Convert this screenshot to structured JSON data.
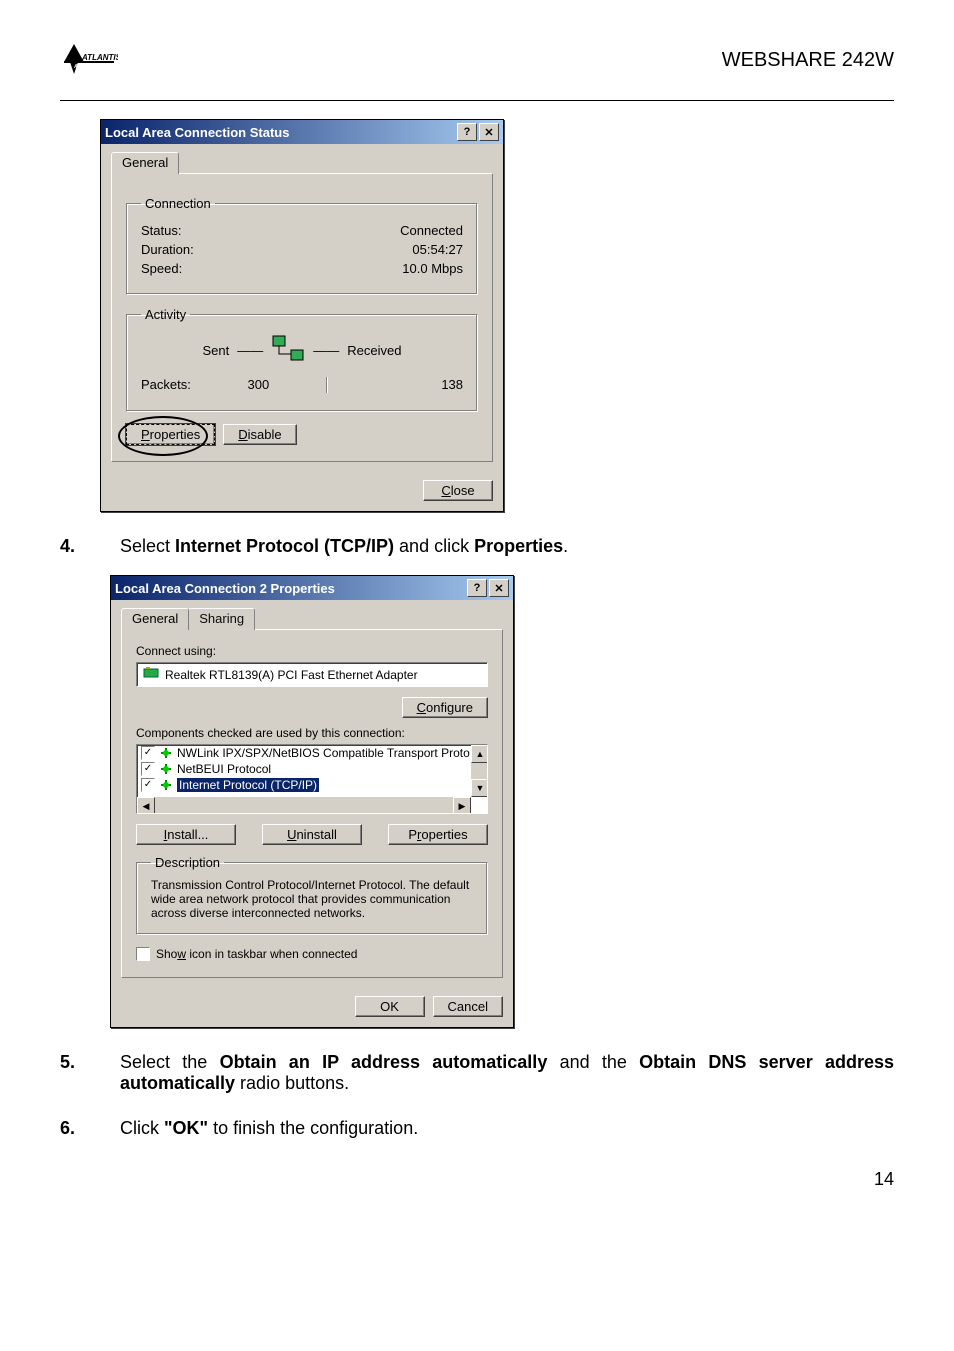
{
  "header": {
    "logo_text": "ATLANTIS",
    "product": "WEBSHARE 242W"
  },
  "dialog1": {
    "title": "Local Area Connection Status",
    "tab_general": "General",
    "conn_legend": "Connection",
    "status_label": "Status:",
    "status_value": "Connected",
    "duration_label": "Duration:",
    "duration_value": "05:54:27",
    "speed_label": "Speed:",
    "speed_value": "10.0 Mbps",
    "activity_legend": "Activity",
    "sent_label": "Sent",
    "received_label": "Received",
    "packets_label": "Packets:",
    "packets_sent": "300",
    "packets_recv": "138",
    "btn_properties": "Properties",
    "btn_disable": "Disable",
    "btn_close": "Close"
  },
  "step4": {
    "num": "4.",
    "pre": "Select ",
    "bold": "Internet Protocol (TCP/IP)",
    "mid": " and click ",
    "bold2": "Properties",
    "post": "."
  },
  "dialog2": {
    "title": "Local Area Connection 2 Properties",
    "tab_general": "General",
    "tab_sharing": "Sharing",
    "connect_using": "Connect using:",
    "adapter": "Realtek RTL8139(A) PCI Fast Ethernet Adapter",
    "btn_configure": "Configure",
    "components_label": "Components checked are used by this connection:",
    "item1": "NWLink IPX/SPX/NetBIOS Compatible Transport Proto",
    "item2": "NetBEUI Protocol",
    "item3": "Internet Protocol (TCP/IP)",
    "btn_install": "Install...",
    "btn_uninstall": "Uninstall",
    "btn_properties": "Properties",
    "desc_legend": "Description",
    "desc_text": "Transmission Control Protocol/Internet Protocol. The default wide area network protocol that provides communication across diverse interconnected networks.",
    "show_icon": "Show icon in taskbar when connected",
    "btn_ok": "OK",
    "btn_cancel": "Cancel"
  },
  "step5": {
    "num": "5.",
    "t1": "Select the ",
    "b1": "Obtain an IP address automatically",
    "t2": " and the ",
    "b2": "Obtain DNS server address automatically",
    "t3": " radio buttons."
  },
  "step6": {
    "num": "6.",
    "t1": "Click ",
    "b1": "\"OK\"",
    "t2": " to finish the configuration."
  },
  "page_number": "14"
}
